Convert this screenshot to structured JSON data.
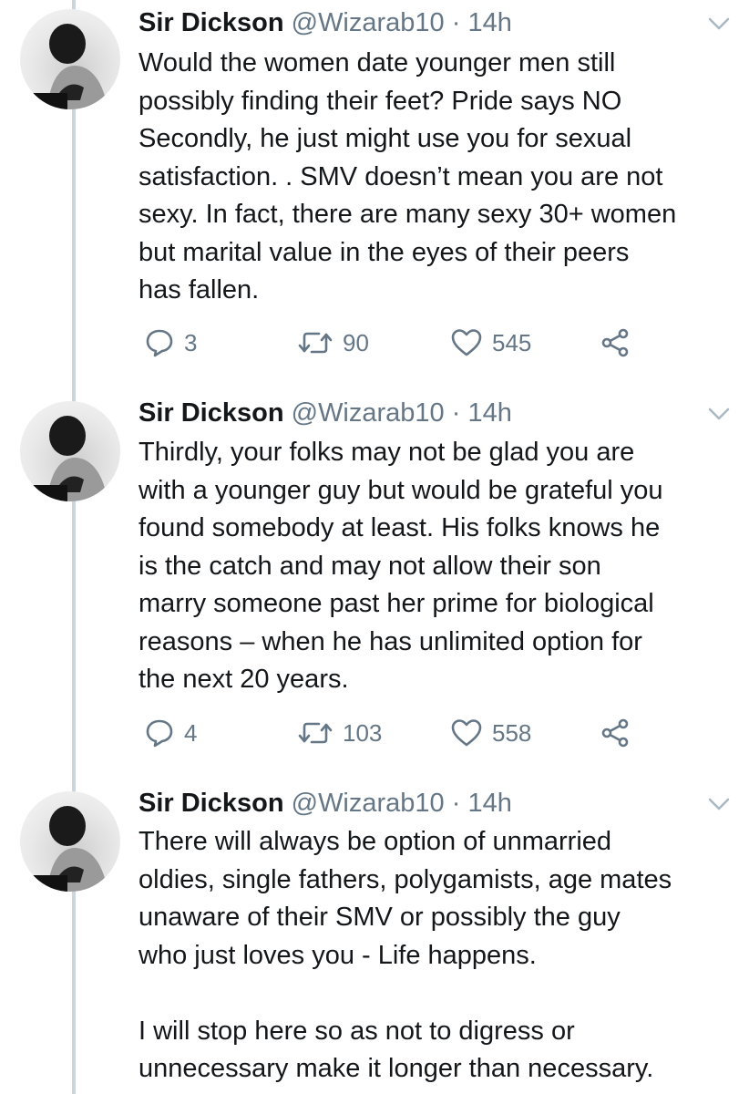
{
  "tweets": [
    {
      "name": "Sir Dickson",
      "handle": "@Wizarab10",
      "time": "· 14h",
      "lines": [
        "Would the women date younger men still",
        "possibly finding their feet? Pride says NO",
        "Secondly, he just might use you for sexual",
        "satisfaction. . SMV doesn’t mean you are not",
        "sexy. In fact, there are many sexy 30+ women",
        "but marital value in the eyes of their peers",
        "has fallen."
      ],
      "replies": "3",
      "retweets": "90",
      "likes": "545"
    },
    {
      "name": "Sir Dickson",
      "handle": "@Wizarab10",
      "time": "· 14h",
      "lines": [
        "Thirdly, your folks may not be glad you are",
        "with a younger guy but would be grateful you",
        "found somebody at least. His folks knows he",
        "is the catch and may not allow their son",
        "marry someone past her prime for biological",
        "reasons – when he has unlimited option for",
        "the next 20 years."
      ],
      "replies": "4",
      "retweets": "103",
      "likes": "558"
    },
    {
      "name": "Sir Dickson",
      "handle": "@Wizarab10",
      "time": "· 14h",
      "lines": [
        "There will always be option of unmarried",
        "oldies, single fathers, polygamists, age mates",
        "unaware of their SMV or possibly the guy",
        "who just loves you - Life happens.",
        "",
        "I will stop here so as not to digress or",
        "unnecessary make it longer than necessary."
      ]
    }
  ],
  "icons": {
    "reply": "reply-icon",
    "retweet": "retweet-icon",
    "like": "heart-icon",
    "share": "share-icon",
    "caret": "chevron-down-icon"
  },
  "colors": {
    "text": "#14171a",
    "secondary": "#657786",
    "thread_line": "#ccd6dd"
  }
}
